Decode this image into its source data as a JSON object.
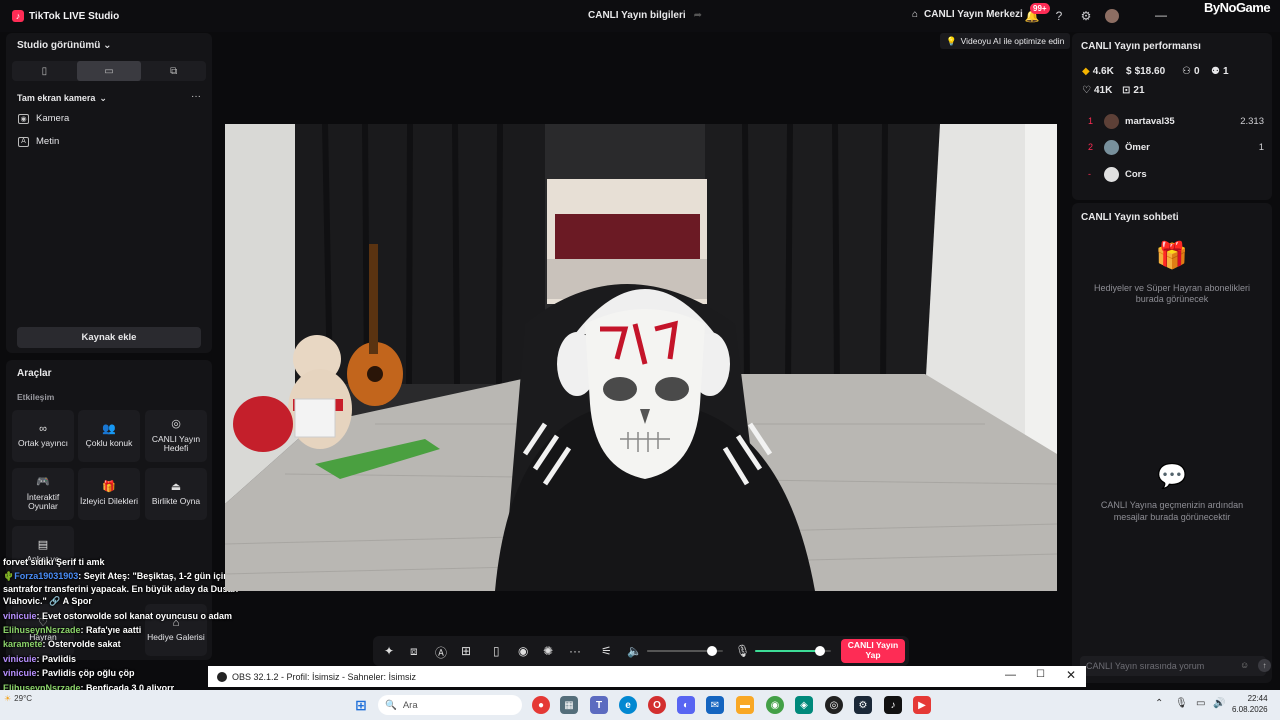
{
  "app": {
    "title": "TikTok LIVE Studio",
    "watermark": "ByNoGame"
  },
  "header": {
    "center_title": "CANLI Yayın bilgileri",
    "live_center": "CANLI Yayın Merkezi",
    "notif_badge": "99+"
  },
  "left": {
    "studio_view": "Studio görünümü",
    "scene_name": "Tam ekran kamera",
    "sources": [
      "Kamera",
      "Metin"
    ],
    "add_source": "Kaynak ekle",
    "tools_title": "Araçlar",
    "engagement": "Etkileşim",
    "tools": [
      "Ortak yayıncı",
      "Çoklu konuk",
      "CANLI Yayın Hedefi",
      "İnteraktif Oyunlar",
      "İzleyici Dilekleri",
      "Birlikte Oyna",
      "Anket ve",
      "Hayran",
      "Hediye Galerisi"
    ]
  },
  "overlay_chat": [
    {
      "user": "",
      "text": "forvet sıdıkı Şerif ti amk"
    },
    {
      "user": "Forza19031903",
      "text": "Seyit Ateş: \"Beşiktaş, 1-2 gün içinde santrafor transferini yapacak. En büyük aday da Dusan Vlahovic.\" 🔗 A Spor"
    },
    {
      "user": "vinicuie",
      "text": "Evet ostorwolde sol kanat oyuncusu o adam"
    },
    {
      "user": "ElihuseynNsrzade",
      "text": "Rafa'yıe aatti"
    },
    {
      "user": "karamete",
      "text": "Ostervolde sakat"
    },
    {
      "user": "vinicuie",
      "text": "Pavlidis"
    },
    {
      "user": "vinicuie",
      "text": "Pavlidis çöp oğlu çöp"
    },
    {
      "user": "ElihuseynNsrzade",
      "text": "Benficada 3 0 aliyorr"
    }
  ],
  "center": {
    "ai_optimize": "Videoyu AI ile optimize edin",
    "go_live": "CANLI Yayın Yap",
    "volume_level": 0.85,
    "mic_level": 0.85
  },
  "perf": {
    "title": "CANLI Yayın performansı",
    "diamonds": "4.6K",
    "earnings": "$18.60",
    "viewers": "0",
    "followers": "1",
    "likes": "41K",
    "gifts": "21",
    "ranking": [
      {
        "rank": "1",
        "name": "martaval35",
        "score": "2.313"
      },
      {
        "rank": "2",
        "name": "Ömer",
        "score": "1"
      },
      {
        "rank": "-",
        "name": "Cors",
        "score": ""
      }
    ]
  },
  "chat": {
    "title": "CANLI Yayın sohbeti",
    "gift_empty": "Hediyeler ve Süper Hayran abonelikleri burada görünecek",
    "chat_empty": "CANLI Yayına geçmenizin ardından mesajlar burada görünecektir",
    "placeholder": "CANLI Yayın sırasında yorum"
  },
  "obs": {
    "title": "OBS 32.1.2 - Profil: İsimsiz - Sahneler: İsimsiz"
  },
  "taskbar": {
    "search": "Ara",
    "weather": "29°C",
    "time": "22:44",
    "date": "6.08.2026"
  },
  "colors": {
    "accent": "#fe2c55",
    "mic_green": "#3ddc97",
    "link_blue": "#4a8df7"
  }
}
